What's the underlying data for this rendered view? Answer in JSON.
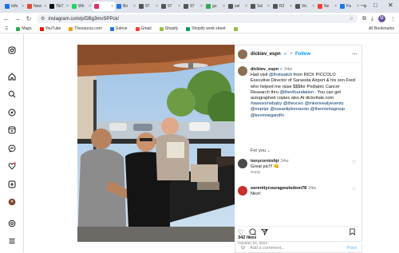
{
  "browser": {
    "tabs": [
      {
        "label": "Info",
        "color": "#1a73e8"
      },
      {
        "label": "New",
        "color": "#ea4335"
      },
      {
        "label": "TikT",
        "color": "#111111"
      },
      {
        "label": "Wh",
        "color": "#25d366"
      },
      {
        "label": "",
        "color": "#e1306c",
        "active": true
      },
      {
        "label": "Bo",
        "color": "#1a73e8"
      },
      {
        "label": "97",
        "color": "#555555"
      },
      {
        "label": "97",
        "color": "#555555"
      },
      {
        "label": "97",
        "color": "#555555"
      },
      {
        "label": "gu",
        "color": "#34a853"
      },
      {
        "label": "sel",
        "color": "#555555"
      },
      {
        "label": "Sel",
        "color": "#555555"
      },
      {
        "label": "R2",
        "color": "#555555"
      },
      {
        "label": "Vic",
        "color": "#555555"
      },
      {
        "label": "Ne",
        "color": "#ea4335"
      },
      {
        "label": "Fa",
        "color": "#1877f2"
      }
    ],
    "url": "instagram.com/p/DBg3mvSPPck/",
    "profile_initial": "M",
    "bookmarks": [
      {
        "label": "Maps",
        "color": "#34a853"
      },
      {
        "label": "YouTube",
        "color": "#ff0000"
      },
      {
        "label": "Thesaurus.com",
        "color": "#f39c12"
      },
      {
        "label": "Gdrive",
        "color": "#1a73e8"
      },
      {
        "label": "Gmail",
        "color": "#ea4335"
      },
      {
        "label": "Shopify",
        "color": "#95bf47"
      },
      {
        "label": "Shopify work sheet",
        "color": "#0f9d58"
      },
      {
        "label": "",
        "color": "#95bf47"
      }
    ],
    "all_bookmarks": "All Bookmarks"
  },
  "post": {
    "username": "dickiev_espn",
    "verified": "✔",
    "follow": "Follow",
    "caption_user": "dickiev_espn",
    "caption_time": "34w",
    "caption_text_1": "Had visit ",
    "mention_1": "@firstwatch",
    "caption_text_2": " from RICK PICCOLO Executive Director of Sarasota Airport & his son Fred who helped me raise $$$for Pediatric Cancer Research thru ",
    "mention_2": "@thevfoundation",
    "caption_text_3": " . You can get autographed copies also At dickvitale.com ",
    "mention_3": "#awesomebaby",
    "mention_4": "@thevceo @mkenvealyevents @espnpr @susanliptonrassio @themontagroup @kevinnegandhi",
    "for_you": "For you",
    "comments": [
      {
        "user": "tonycornishjr",
        "time": "34w",
        "text": "Great pic!!! 👊",
        "reply": "Reply",
        "color": "#4a4a4a"
      },
      {
        "user": "serenitycouragewisdom78",
        "time": "34w",
        "text": "Nice!",
        "reply": "",
        "color": "#c9302c"
      }
    ],
    "likes": "342 likes",
    "date": "October 24, 2024",
    "add_comment": "Add a comment...",
    "post_button": "Post"
  },
  "sidebar_icons": [
    "instagram-logo-icon",
    "home-icon",
    "search-icon",
    "explore-icon",
    "reels-icon",
    "messenger-icon",
    "notifications-icon",
    "create-icon",
    "profile-icon",
    "threads-icon",
    "menu-icon"
  ]
}
